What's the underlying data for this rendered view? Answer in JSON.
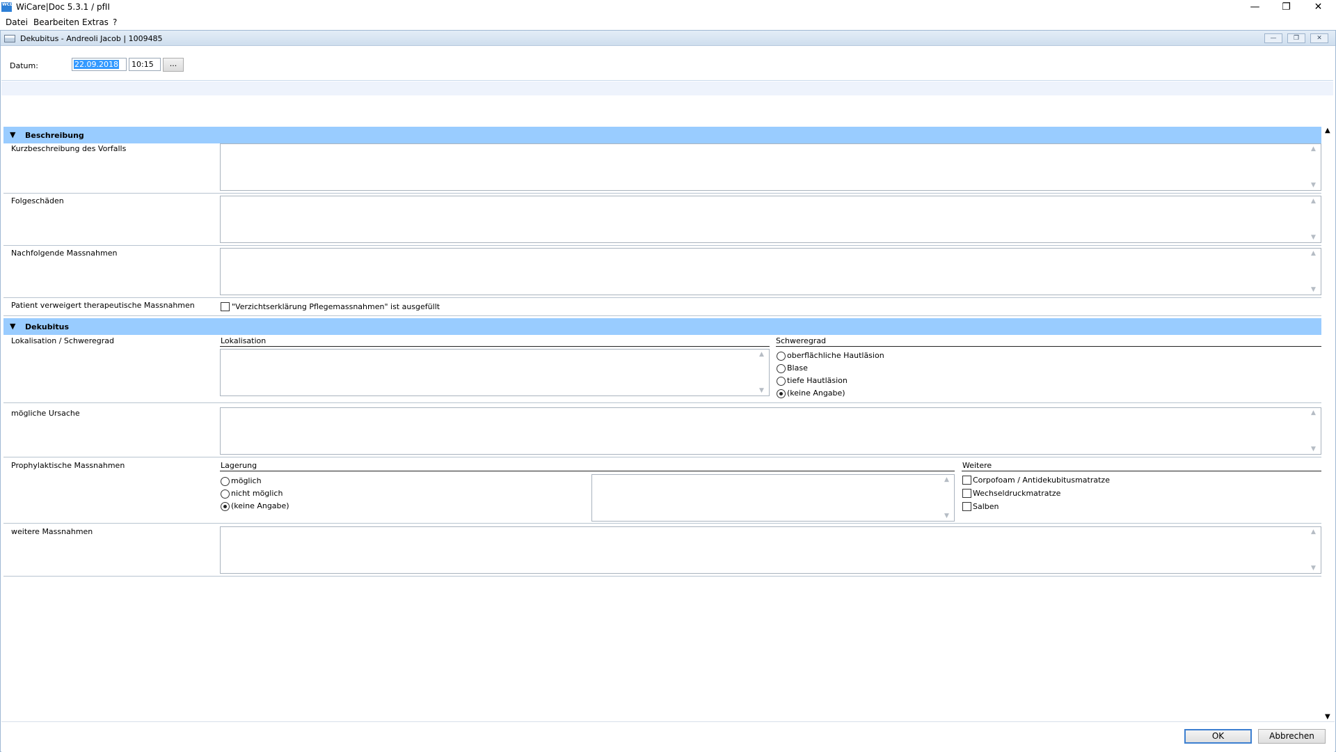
{
  "window": {
    "icon_text": "WCD",
    "title": "WiCare|Doc 5.3.1  / pfII",
    "controls": {
      "minimize": "—",
      "restore": "❐",
      "close": "✕"
    }
  },
  "menu": [
    {
      "label": "Datei"
    },
    {
      "label": "Bearbeiten"
    },
    {
      "label": "Extras"
    },
    {
      "label": "?"
    }
  ],
  "child": {
    "title": "Dekubitus  -  Andreoli Jacob | 1009485",
    "controls": {
      "minimize": "—",
      "restore": "❐",
      "close": "✕"
    }
  },
  "date_row": {
    "label": "Datum:",
    "date_value": "22.09.2018",
    "time_value": "10:15",
    "more_label": "..."
  },
  "sections": {
    "beschreibung": {
      "title": "Beschreibung",
      "kurzbeschreibung_label": "Kurzbeschreibung des Vorfalls",
      "folgeschaeden_label": "Folgeschäden",
      "nachfolgende_label": "Nachfolgende Massnahmen",
      "verweigert_label": "Patient verweigert therapeutische Massnahmen",
      "verweigert_checkbox_label": "\"Verzichtserklärung Pflegemassnahmen\" ist ausgefüllt"
    },
    "dekubitus": {
      "title": "Dekubitus",
      "lokalisation_row_label": "Lokalisation / Schweregrad",
      "lokalisation_group": "Lokalisation",
      "schweregrad_group": "Schweregrad",
      "schweregrad_options": [
        "oberflächliche Hautläsion",
        "Blase",
        "tiefe Hautläsion",
        "(keine Angabe)"
      ],
      "schweregrad_selected": "(keine Angabe)",
      "ursache_label": "mögliche Ursache",
      "prophylaxe_label": "Prophylaktische Massnahmen",
      "lagerung_group": "Lagerung",
      "lagerung_options": [
        "möglich",
        "nicht möglich",
        "(keine Angabe)"
      ],
      "lagerung_selected": "(keine Angabe)",
      "weitere_group": "Weitere",
      "weitere_options": [
        "Corpofoam / Antidekubitusmatratze",
        "Wechseldruckmatratze",
        "Salben"
      ],
      "weitere_massnahmen_label": "weitere Massnahmen"
    }
  },
  "footer": {
    "ok_label": "OK",
    "cancel_label": "Abbrechen"
  }
}
